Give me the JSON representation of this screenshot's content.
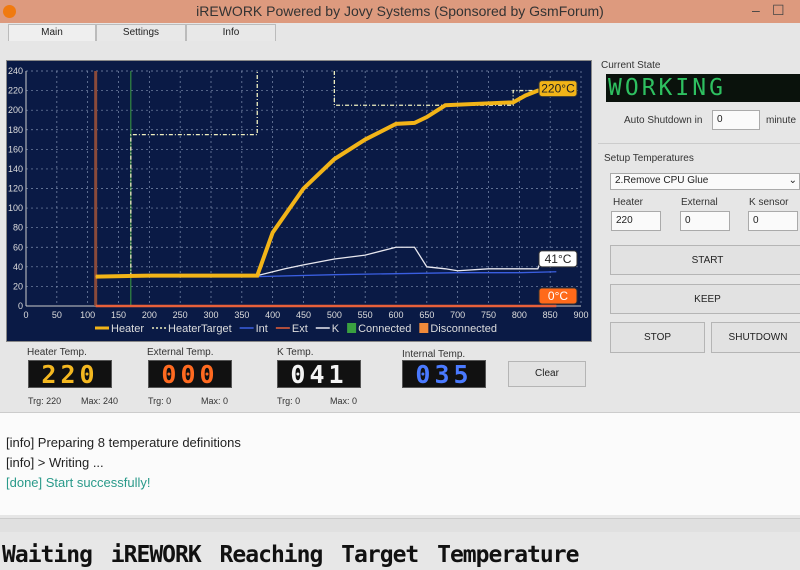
{
  "window": {
    "title": "iREWORK Powered by Jovy Systems (Sponsored by GsmForum)",
    "minimize": "–",
    "maximize": "☐"
  },
  "tabs": [
    {
      "label": "Main"
    },
    {
      "label": "Settings"
    },
    {
      "label": "Info"
    }
  ],
  "chart_data": {
    "type": "line",
    "xlim": [
      0,
      900
    ],
    "ylim": [
      0,
      240
    ],
    "xticks": [
      "0",
      "50",
      "100",
      "150",
      "200",
      "250",
      "300",
      "350",
      "400",
      "450",
      "500",
      "550",
      "600",
      "650",
      "700",
      "750",
      "800",
      "850",
      "900"
    ],
    "yticks": [
      "0",
      "20",
      "40",
      "60",
      "80",
      "100",
      "120",
      "140",
      "160",
      "180",
      "200",
      "220",
      "240"
    ],
    "grid": true,
    "legend_placement": "bottom",
    "legend": [
      {
        "name": "Heater",
        "color": "#f2b418"
      },
      {
        "name": "HeaterTarget",
        "color": "#f0f0c0"
      },
      {
        "name": "Int",
        "color": "#3a5ee0"
      },
      {
        "name": "Ext",
        "color": "#e8603a"
      },
      {
        "name": "K",
        "color": "#e8e8f0"
      },
      {
        "name": "Connected",
        "color": "#3aa040"
      },
      {
        "name": "Disconnected",
        "color": "#f08a3a"
      }
    ],
    "series": [
      {
        "name": "Heater",
        "color": "#f2b418",
        "x": [
          113,
          200,
          300,
          375,
          400,
          450,
          500,
          550,
          600,
          630,
          650,
          680,
          750,
          790,
          810,
          830,
          860
        ],
        "y": [
          30,
          31,
          31,
          31,
          75,
          120,
          150,
          170,
          186,
          187,
          193,
          205,
          207,
          208,
          215,
          220,
          220
        ]
      },
      {
        "name": "HeaterTarget",
        "color": "#f0f0c0",
        "x": [
          170,
          170,
          375,
          375,
          null,
          500,
          500,
          790,
          790,
          860
        ],
        "y": [
          30,
          175,
          175,
          240,
          null,
          240,
          205,
          205,
          220,
          220
        ]
      },
      {
        "name": "Int",
        "color": "#3a5ee0",
        "x": [
          113,
          375,
          500,
          600,
          700,
          800,
          860
        ],
        "y": [
          30,
          30,
          32,
          33,
          34,
          34,
          35
        ]
      },
      {
        "name": "Ext",
        "color": "#e8603a",
        "x": [
          113,
          860
        ],
        "y": [
          0,
          0
        ]
      },
      {
        "name": "K",
        "color": "#e8e8f0",
        "x": [
          113,
          375,
          420,
          450,
          500,
          550,
          600,
          630,
          650,
          680,
          700,
          750,
          800,
          830,
          835,
          860
        ],
        "y": [
          30,
          31,
          38,
          42,
          48,
          52,
          60,
          60,
          40,
          38,
          36,
          38,
          38,
          38,
          46,
          41
        ]
      }
    ],
    "markers": [
      {
        "x": 113,
        "color": "#8a4a3a"
      },
      {
        "x": 170,
        "color": "#3aa040"
      }
    ],
    "annotations": [
      {
        "label": "220°C",
        "color": "#f2b418",
        "value": 220
      },
      {
        "label": "41°C",
        "color": "#ffffff",
        "value": 41
      },
      {
        "label": "0°C",
        "color": "#ff6a1a",
        "value": 0
      }
    ]
  },
  "displays": [
    {
      "label": "Heater Temp.",
      "value": "220",
      "trg": "Trg: 220",
      "max": "Max: 240",
      "color": "#f4b820"
    },
    {
      "label": "External Temp.",
      "value": "000",
      "trg": "Trg: 0",
      "max": "Max: 0",
      "color": "#ff6a20"
    },
    {
      "label": "K Temp.",
      "value": "041",
      "trg": "Trg: 0",
      "max": "Max: 0",
      "color": "#f4f4f4"
    },
    {
      "label": "Internal Temp.",
      "value": "035",
      "color": "#4a7aff"
    }
  ],
  "clear_label": "Clear",
  "state": {
    "label": "Current State",
    "value": "WORKING",
    "auto_label": "Auto Shutdown in",
    "auto_value": "0",
    "unit": "minute"
  },
  "setup": {
    "label": "Setup Temperatures",
    "profile": "2.Remove CPU Glue",
    "heater_label": "Heater",
    "heater": "220",
    "external_label": "External",
    "external": "0",
    "k_label": "K sensor",
    "k": "0"
  },
  "buttons": {
    "start": "START",
    "keep": "KEEP",
    "stop": "STOP",
    "shutdown": "SHUTDOWN"
  },
  "log": [
    {
      "text": "[info] Preparing 8 temperature definitions",
      "color": "#222"
    },
    {
      "text": "[info] > Writing ...",
      "color": "#222"
    },
    {
      "text": "[done] Start successfully!",
      "color": "#2a9a8a"
    }
  ],
  "caption": "Waiting iREWORK Reaching Target Temperature"
}
